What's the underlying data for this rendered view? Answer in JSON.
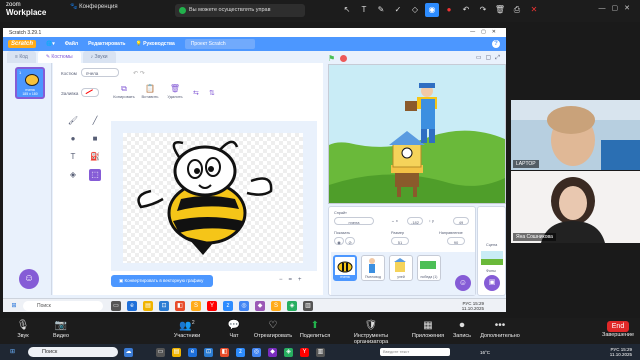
{
  "zoom": {
    "app_name_top": "zoom",
    "app_name_bottom": "Workplace",
    "conference_tab": "Конференция",
    "share_banner": "Вы можете осуществлять управ",
    "annotation_icons": [
      "select-icon",
      "text-icon",
      "pen-icon",
      "check-icon",
      "eraser-icon",
      "spotlight-icon",
      "stamp-icon",
      "undo-icon",
      "redo-icon",
      "trash-icon",
      "save-icon",
      "close-icon"
    ],
    "toolbar": [
      {
        "name": "audio",
        "label": "Звук",
        "icon": "🎙"
      },
      {
        "name": "video",
        "label": "Видео",
        "icon": "📷"
      },
      {
        "name": "participants",
        "label": "Участники",
        "icon": "👥",
        "count": "2"
      },
      {
        "name": "chat",
        "label": "Чат",
        "icon": "💬"
      },
      {
        "name": "react",
        "label": "Отреагировать",
        "icon": "♡"
      },
      {
        "name": "share",
        "label": "Поделиться",
        "icon": "⬆"
      },
      {
        "name": "host-tools",
        "label": "Инструменты организатора",
        "icon": "🛡"
      },
      {
        "name": "apps",
        "label": "Приложения",
        "icon": "▦"
      },
      {
        "name": "record",
        "label": "Запись",
        "icon": "⏺"
      },
      {
        "name": "more",
        "label": "Дополнительно",
        "icon": "•••"
      },
      {
        "name": "end",
        "label": "Завершение",
        "icon": "End"
      }
    ]
  },
  "scratch": {
    "window_title": "Scratch 3.29.1",
    "logo": "Scratch",
    "menu": [
      "Файл",
      "Редактировать",
      "Руководства"
    ],
    "project_title": "Проект Scratch",
    "tabs": [
      "Код",
      "Костюмы",
      "Звуки"
    ],
    "costume": {
      "number": "1",
      "name": "пчела",
      "size": "185 x 180"
    },
    "editor": {
      "costume_label": "Костюм",
      "costume_name": "пчела",
      "fill_label": "Заливка",
      "buttons": [
        "Копировать",
        "Вставить",
        "Удалить"
      ],
      "convert_button": "Конвертировать в векторную графику",
      "zoom_icons": [
        "−",
        "=",
        "+"
      ]
    },
    "sprite_info": {
      "sprite_label": "Спрайт",
      "sprite_name": "пчела",
      "x_label": "x",
      "x_value": "-182",
      "y_label": "y",
      "y_value": "49",
      "show_label": "Показать",
      "size_label": "Размер",
      "size_value": "51",
      "direction_label": "Направление",
      "direction_value": "90",
      "sprites": [
        "пчела",
        "Пчеловод",
        "улей",
        "победа (1)"
      ]
    },
    "stage_panel": {
      "label": "Сцена",
      "backdrops_label": "Фоны",
      "backdrops_count": "2"
    }
  },
  "inner_taskbar": {
    "search": "Поиск",
    "lang": "РУС",
    "time": "15:29",
    "date": "11.10.2025"
  },
  "participants": [
    {
      "name": "LAPTOP"
    },
    {
      "name": "Яна Сошникова"
    }
  ],
  "outer_taskbar": {
    "search": "Поиск",
    "input_placeholder": "Введите текст",
    "lang": "РУС",
    "time": "15:29",
    "date": "11.10.2025",
    "temperature": "16°C"
  },
  "colors": {
    "scratch_blue": "#4c97ff",
    "scratch_purple": "#855cd6",
    "zoom_bg": "#1c1c1c",
    "share_green": "#22b14c",
    "end_red": "#e02828"
  }
}
